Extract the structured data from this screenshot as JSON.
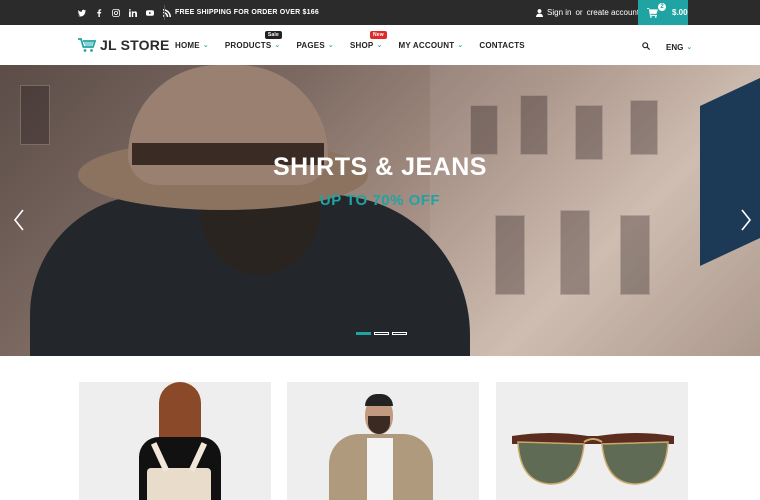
{
  "topbar": {
    "social_icons": [
      "twitter-icon",
      "facebook-icon",
      "instagram-icon",
      "linkedin-icon",
      "youtube-icon",
      "rss-icon"
    ],
    "shipping_text": "FREE SHIPPING FOR ORDER OVER $166",
    "sign_in": "Sign in",
    "or": "or",
    "create_account": "create account",
    "cart_count": "2",
    "cart_amount": "$.00"
  },
  "header": {
    "logo_text": "JL STORE",
    "nav": [
      {
        "label": "HOME",
        "chevron": "⌄"
      },
      {
        "label": "PRODUCTS",
        "chevron": "⌄",
        "badge": "Sale"
      },
      {
        "label": "PAGES",
        "chevron": "⌄"
      },
      {
        "label": "SHOP",
        "chevron": "⌄",
        "badge": "New"
      },
      {
        "label": "MY ACCOUNT",
        "chevron": "⌄"
      },
      {
        "label": "CONTACTS"
      }
    ],
    "language": "ENG",
    "language_chevron": "⌄"
  },
  "hero": {
    "title": "SHIRTS & JEANS",
    "subtitle": "UP TO 70% OFF",
    "slides": 3,
    "active_slide": 1
  },
  "products": [
    {
      "image": "woman-with-backpack"
    },
    {
      "image": "man-in-jacket"
    },
    {
      "image": "sunglasses"
    }
  ],
  "colors": {
    "accent": "#20a3a3",
    "topbar": "#2b2b2b",
    "sale_badge": "#222222",
    "new_badge": "#e02929"
  }
}
